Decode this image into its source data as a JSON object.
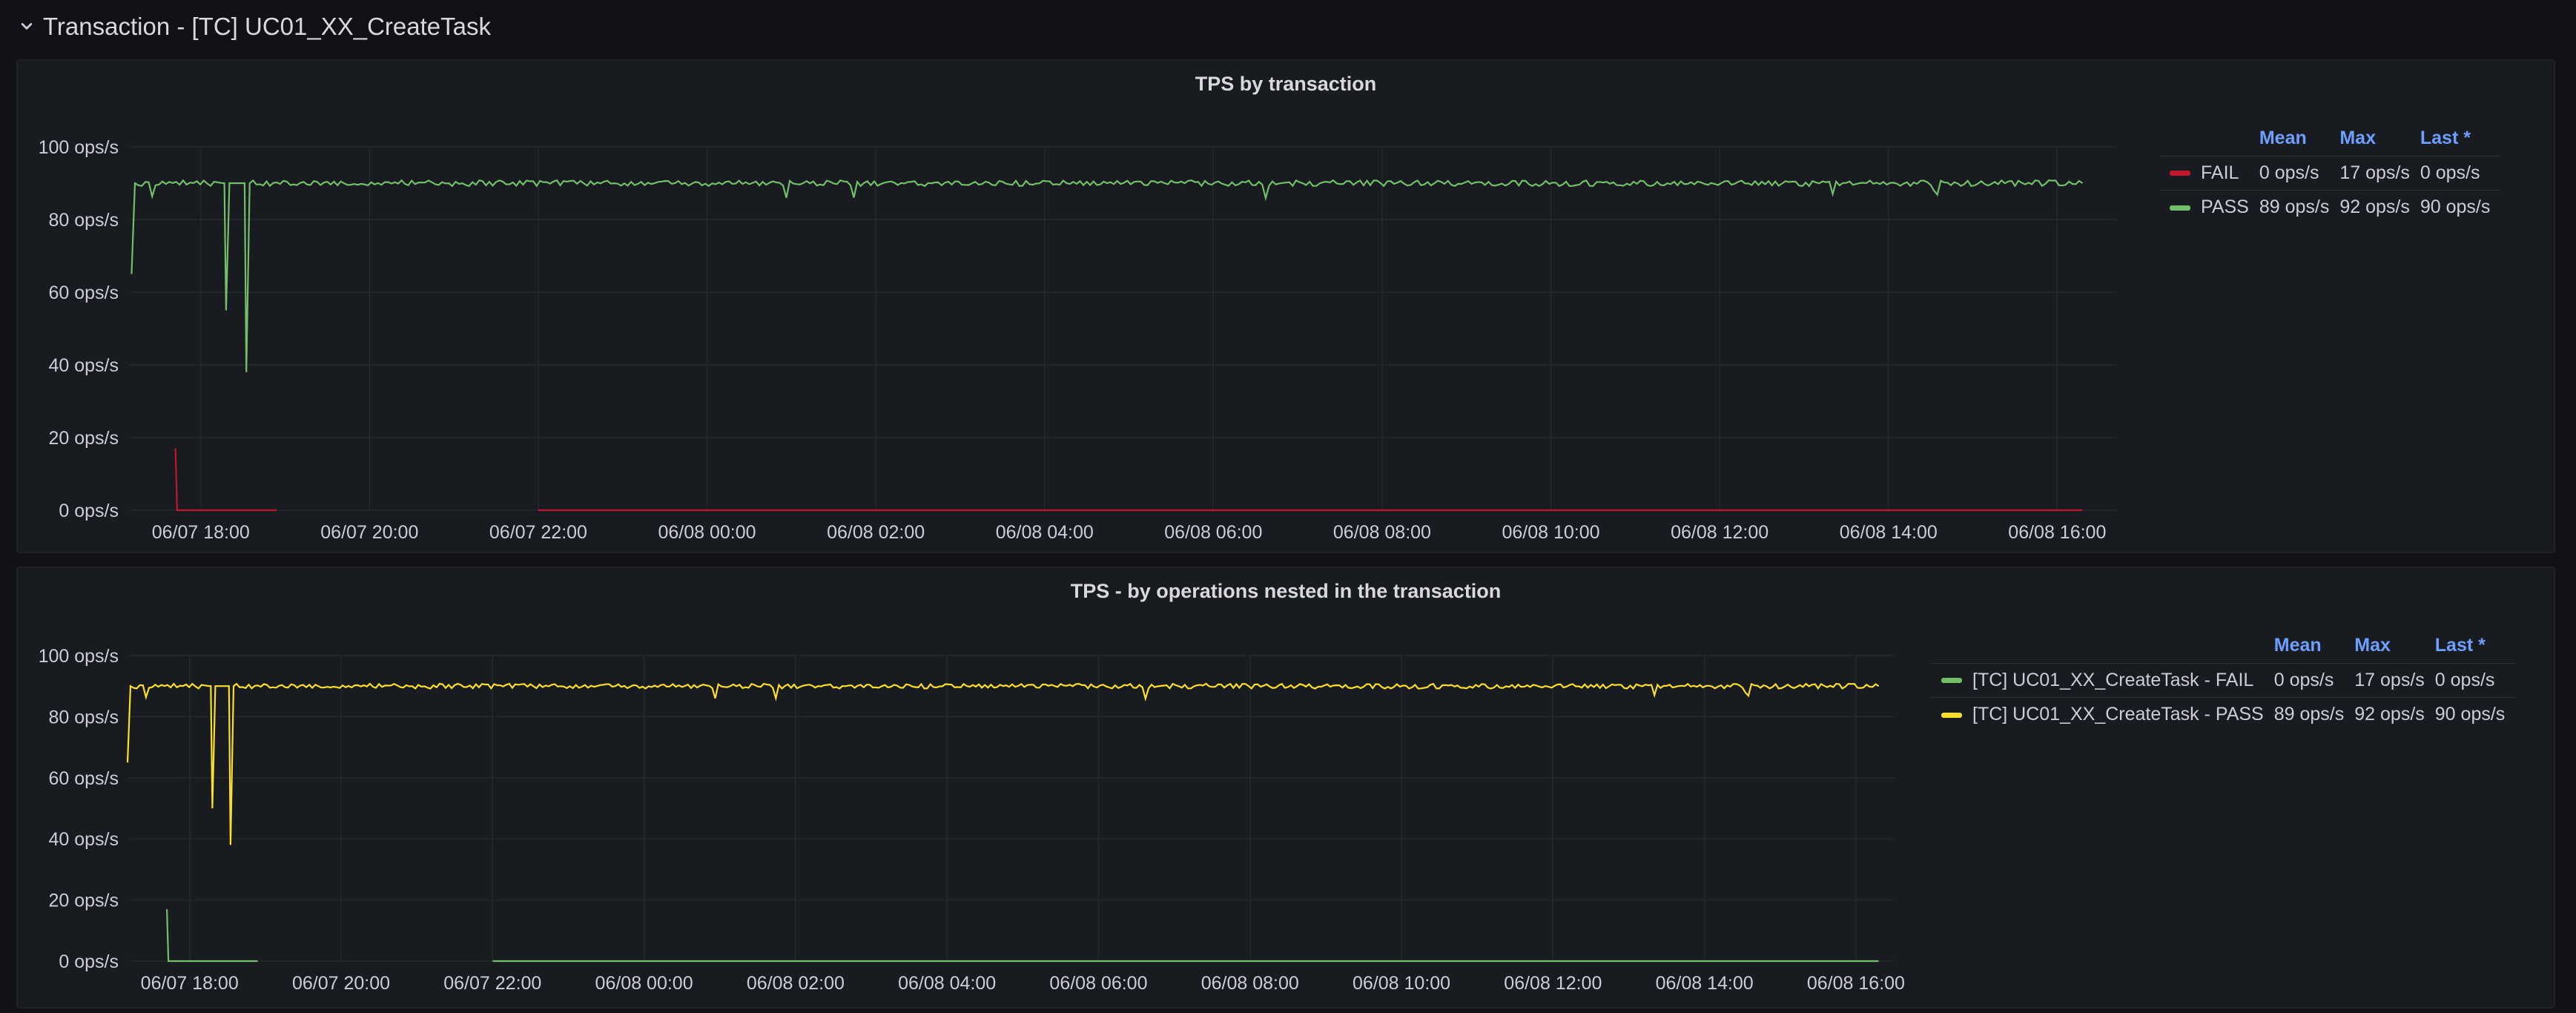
{
  "row": {
    "title": "Transaction - [TC] UC01_XX_CreateTask"
  },
  "colors": {
    "fail": "#c4162a",
    "pass": "#73bf69",
    "yellow": "#fade2a",
    "grid": "#25282d",
    "header": "#6e9fff"
  },
  "panels": [
    {
      "title": "TPS by transaction",
      "legend": {
        "headers": {
          "mean": "Mean",
          "max": "Max",
          "last": "Last *"
        },
        "rows": [
          {
            "name": "FAIL",
            "color": "#c4162a",
            "mean": "0 ops/s",
            "max": "17 ops/s",
            "last": "0 ops/s"
          },
          {
            "name": "PASS",
            "color": "#73bf69",
            "mean": "89 ops/s",
            "max": "92 ops/s",
            "last": "90 ops/s"
          }
        ]
      },
      "chart_data": {
        "type": "line",
        "title": "TPS by transaction",
        "yunit": "ops/s",
        "ylim": [
          0,
          100
        ],
        "y_ticks": [
          "0 ops/s",
          "20 ops/s",
          "40 ops/s",
          "60 ops/s",
          "80 ops/s",
          "100 ops/s"
        ],
        "x_ticks": [
          "06/07 18:00",
          "06/07 20:00",
          "06/07 22:00",
          "06/08 00:00",
          "06/08 02:00",
          "06/08 04:00",
          "06/08 06:00",
          "06/08 08:00",
          "06/08 10:00",
          "06/08 12:00",
          "06/08 14:00",
          "06/08 16:00"
        ],
        "x_range_hours": [
          -0.85,
          22.7
        ],
        "grid": true,
        "legend_position": "right",
        "series": [
          {
            "name": "FAIL",
            "color": "#c4162a",
            "segments": [
              {
                "points": [
                  [
                    -0.3,
                    17
                  ],
                  [
                    -0.28,
                    0
                  ],
                  [
                    0.9,
                    0
                  ]
                ]
              },
              {
                "points": [
                  [
                    4.0,
                    0
                  ],
                  [
                    22.3,
                    0
                  ]
                ]
              }
            ]
          },
          {
            "name": "PASS",
            "color": "#73bf69",
            "segments": [
              {
                "points": [
                  [
                    -0.82,
                    65
                  ],
                  [
                    -0.78,
                    90
                  ],
                  [
                    0.28,
                    90
                  ],
                  [
                    0.3,
                    55
                  ],
                  [
                    0.34,
                    90
                  ],
                  [
                    0.52,
                    90
                  ],
                  [
                    0.54,
                    38
                  ],
                  [
                    0.58,
                    90
                  ],
                  [
                    22.3,
                    90
                  ]
                ]
              }
            ]
          }
        ]
      }
    },
    {
      "title": "TPS - by operations nested in the transaction",
      "legend": {
        "headers": {
          "mean": "Mean",
          "max": "Max",
          "last": "Last *"
        },
        "rows": [
          {
            "name": "[TC] UC01_XX_CreateTask - FAIL",
            "color": "#73bf69",
            "mean": "0 ops/s",
            "max": "17 ops/s",
            "last": "0 ops/s"
          },
          {
            "name": "[TC] UC01_XX_CreateTask - PASS",
            "color": "#fade2a",
            "mean": "89 ops/s",
            "max": "92 ops/s",
            "last": "90 ops/s"
          }
        ]
      },
      "chart_data": {
        "type": "line",
        "title": "TPS - by operations nested in the transaction",
        "yunit": "ops/s",
        "ylim": [
          0,
          100
        ],
        "y_ticks": [
          "0 ops/s",
          "20 ops/s",
          "40 ops/s",
          "60 ops/s",
          "80 ops/s",
          "100 ops/s"
        ],
        "x_ticks": [
          "06/07 18:00",
          "06/07 20:00",
          "06/07 22:00",
          "06/08 00:00",
          "06/08 02:00",
          "06/08 04:00",
          "06/08 06:00",
          "06/08 08:00",
          "06/08 10:00",
          "06/08 12:00",
          "06/08 14:00",
          "06/08 16:00"
        ],
        "x_range_hours": [
          -0.8,
          22.5
        ],
        "grid": true,
        "legend_position": "right",
        "series": [
          {
            "name": "[TC] UC01_XX_CreateTask - FAIL",
            "color": "#73bf69",
            "segments": [
              {
                "points": [
                  [
                    -0.3,
                    17
                  ],
                  [
                    -0.28,
                    0
                  ],
                  [
                    0.9,
                    0
                  ]
                ]
              },
              {
                "points": [
                  [
                    4.0,
                    0
                  ],
                  [
                    22.3,
                    0
                  ]
                ]
              }
            ]
          },
          {
            "name": "[TC] UC01_XX_CreateTask - PASS",
            "color": "#fade2a",
            "segments": [
              {
                "points": [
                  [
                    -0.82,
                    65
                  ],
                  [
                    -0.78,
                    90
                  ],
                  [
                    0.28,
                    90
                  ],
                  [
                    0.3,
                    50
                  ],
                  [
                    0.34,
                    90
                  ],
                  [
                    0.52,
                    90
                  ],
                  [
                    0.54,
                    38
                  ],
                  [
                    0.58,
                    90
                  ],
                  [
                    22.3,
                    90
                  ]
                ]
              }
            ]
          }
        ]
      }
    }
  ]
}
